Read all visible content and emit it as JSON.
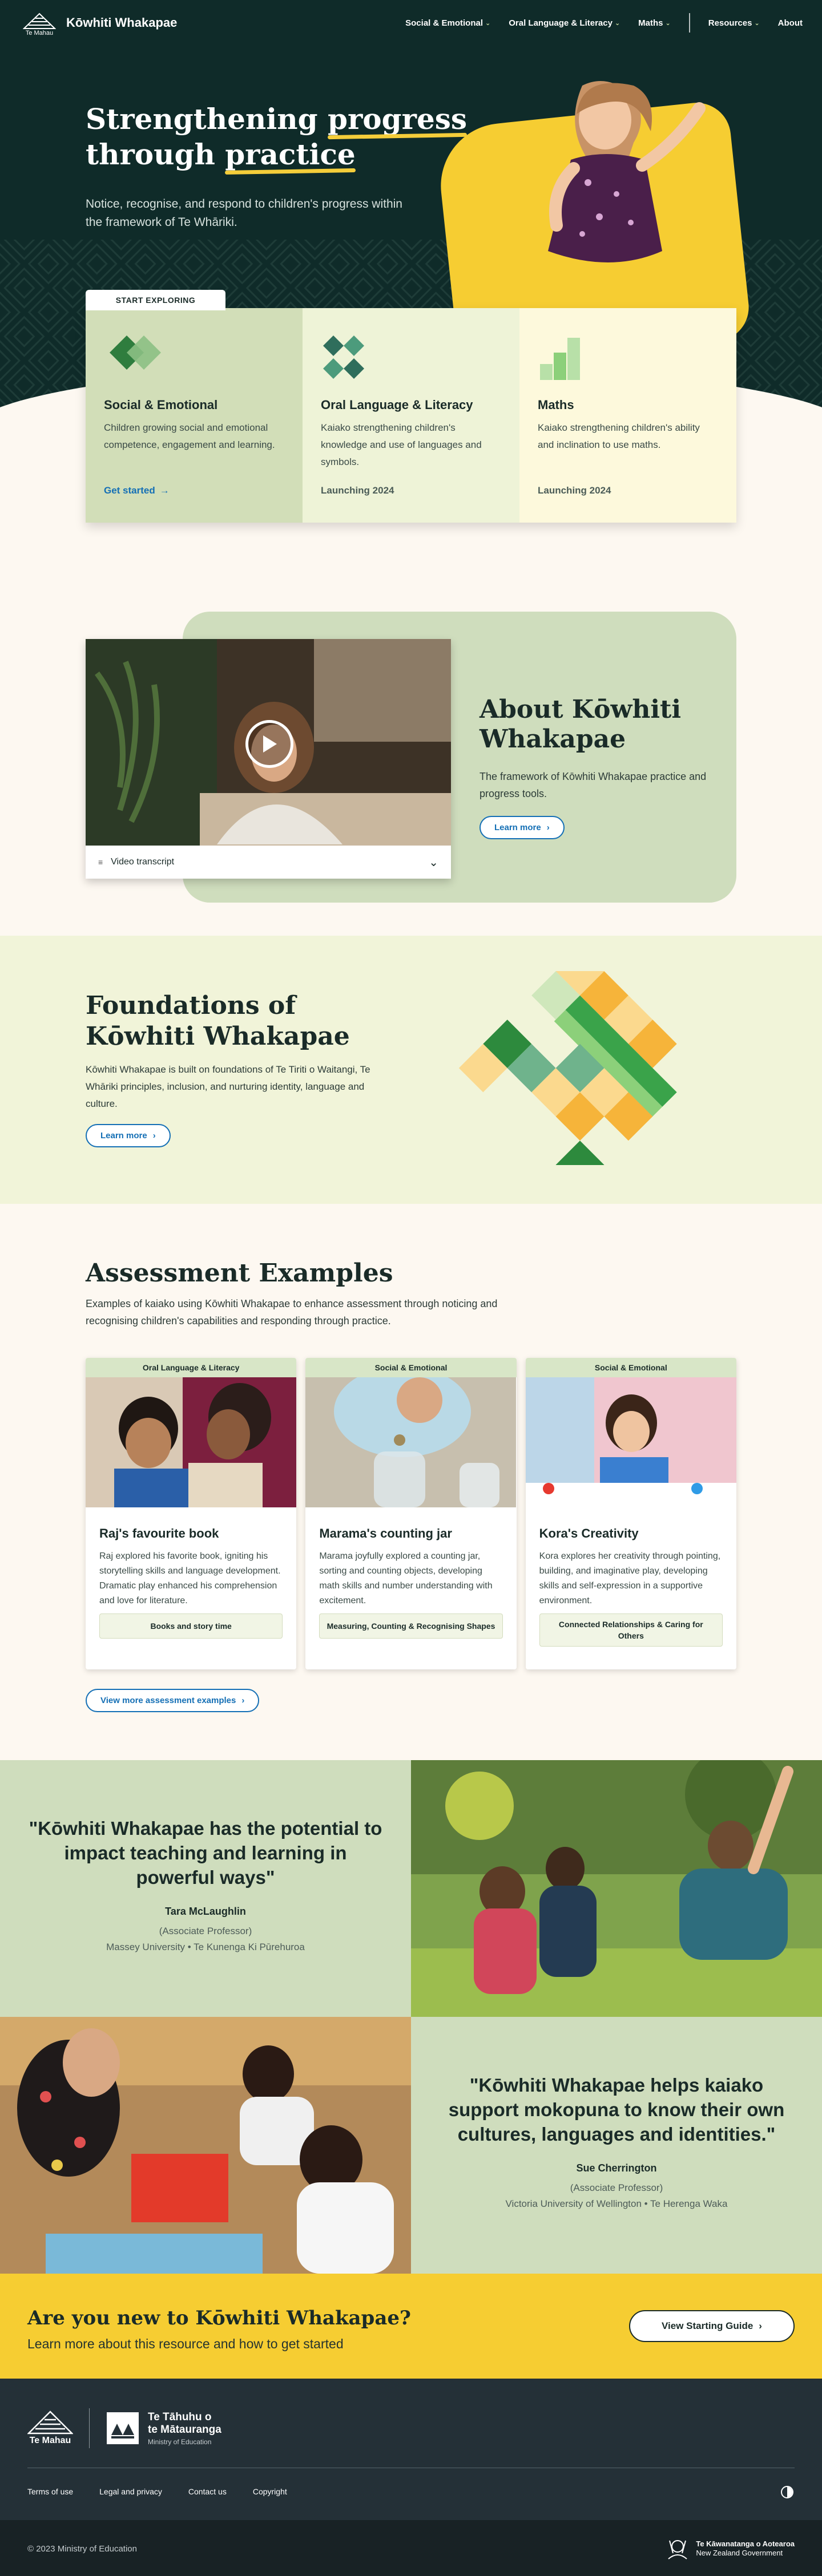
{
  "header": {
    "logo_text": "Te Mahau",
    "site_title": "Kōwhiti Whakapae",
    "nav": [
      {
        "label": "Social & Emotional",
        "has_dropdown": true
      },
      {
        "label": "Oral Language & Literacy",
        "has_dropdown": true
      },
      {
        "label": "Maths",
        "has_dropdown": true
      },
      {
        "label": "Resources",
        "has_dropdown": true
      },
      {
        "label": "About",
        "has_dropdown": false
      }
    ]
  },
  "hero": {
    "title_line1_a": "Strengthening ",
    "title_line1_b": "progress",
    "title_line2_a": "through ",
    "title_line2_b": "practice",
    "subtitle": "Notice, recognise, and respond to children's progress within the framework of Te Whāriki."
  },
  "explore": {
    "tab_label": "START EXPLORING",
    "cards": [
      {
        "title": "Social & Emotional",
        "desc": "Children growing social and emotional competence, engagement and learning.",
        "footer": "Get started",
        "is_link": true,
        "bg": "#d2deb8",
        "icon": "social-emotional-icon"
      },
      {
        "title": "Oral Language & Literacy",
        "desc": "Kaiako strengthening children's knowledge and use of languages and symbols.",
        "footer": "Launching 2024",
        "is_link": false,
        "bg": "#eef3d7",
        "icon": "oral-language-icon"
      },
      {
        "title": "Maths",
        "desc": "Kaiako strengthening children's ability and inclination to use maths.",
        "footer": "Launching 2024",
        "is_link": false,
        "bg": "#fdf9dc",
        "icon": "maths-icon"
      }
    ]
  },
  "about": {
    "video_transcript_label": "Video transcript",
    "title": "About Kōwhiti Whakapae",
    "desc": "The framework of Kōwhiti Whakapae practice and progress tools.",
    "button": "Learn more"
  },
  "foundations": {
    "title": "Foundations of Kōwhiti Whakapae",
    "desc": "Kōwhiti Whakapae is built on foundations of Te Tiriti o Waitangi, Te Whāriki principles, inclusion, and nurturing identity, language and culture.",
    "button": "Learn more"
  },
  "assessment": {
    "title": "Assessment Examples",
    "desc": "Examples of kaiako using Kōwhiti Whakapae to enhance assessment through noticing and recognising children's capabilities and responding through practice.",
    "cards": [
      {
        "tag": "Oral Language & Literacy",
        "title": "Raj's favourite book",
        "desc": "Raj explored his favorite book, igniting his storytelling skills and language development. Dramatic play enhanced his comprehension and love for literature.",
        "chip": "Books and story time"
      },
      {
        "tag": "Social & Emotional",
        "title": "Marama's counting jar",
        "desc": "Marama joyfully explored a counting jar, sorting and counting objects, developing math skills and number understanding with excitement.",
        "chip": "Measuring, Counting & Recognising Shapes"
      },
      {
        "tag": "Social & Emotional",
        "title": "Kora's Creativity",
        "desc": "Kora explores her creativity through pointing, building, and imaginative play, developing skills and self-expression in a supportive environment.",
        "chip": "Connected Relationships & Caring for Others"
      }
    ],
    "button": "View more assessment examples"
  },
  "quotes": [
    {
      "quote": "\"Kōwhiti Whakapae has the potential to impact teaching and learning in powerful ways\"",
      "name": "Tara McLaughlin",
      "role": "(Associate Professor)",
      "org": "Massey University • Te Kunenga Ki Pūrehuroa"
    },
    {
      "quote": "\"Kōwhiti Whakapae helps kaiako support mokopuna to know their own cultures, languages and identities.\"",
      "name": "Sue Cherrington",
      "role": "(Associate Professor)",
      "org": "Victoria University of Wellington • Te Herenga Waka"
    }
  ],
  "cta": {
    "title": "Are you new to Kōwhiti Whakapae?",
    "desc": "Learn more about this resource and how to get started",
    "button": "View Starting Guide"
  },
  "footer": {
    "logo_text": "Te Mahau",
    "ministry_line1": "Te Tāhuhu o",
    "ministry_line2": "te Mātauranga",
    "ministry_sub": "Ministry of Education",
    "links": [
      "Terms of use",
      "Legal and privacy",
      "Contact us",
      "Copyright"
    ],
    "copyright": "© 2023 Ministry of Education",
    "govt_line1": "Te Kāwanatanga o Aotearoa",
    "govt_line2": "New Zealand Government"
  },
  "colors": {
    "dark_teal": "#0f2b29",
    "yellow": "#f6cd32",
    "sage": "#cfddbd",
    "link_blue": "#146fb5",
    "cream": "#fdf8f1"
  }
}
